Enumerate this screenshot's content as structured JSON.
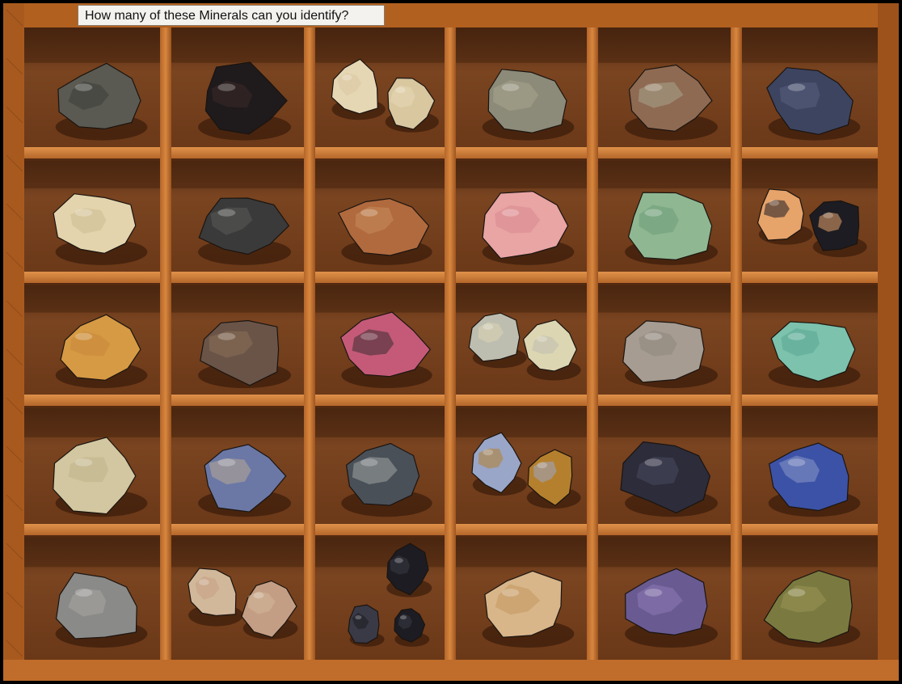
{
  "label": "How many of these Minerals can you identify?",
  "tray": {
    "columns": 6,
    "rows": 5,
    "wood_color": "#b8621f",
    "compartment_color": "#6e3a1c",
    "divider_color": "#c97a36"
  },
  "minerals": [
    {
      "row": 0,
      "col": 0,
      "count": 1,
      "colors": [
        "#5a5a52",
        "#3e3e38"
      ]
    },
    {
      "row": 0,
      "col": 1,
      "count": 1,
      "colors": [
        "#1f1a1c",
        "#3a2a28"
      ]
    },
    {
      "row": 0,
      "col": 2,
      "count": 2,
      "colors": [
        "#e6d7b4",
        "#d9c7a0"
      ]
    },
    {
      "row": 0,
      "col": 3,
      "count": 1,
      "colors": [
        "#8c8a78",
        "#a7a48e"
      ]
    },
    {
      "row": 0,
      "col": 4,
      "count": 1,
      "colors": [
        "#8e6a52",
        "#a8a38a"
      ]
    },
    {
      "row": 0,
      "col": 5,
      "count": 1,
      "colors": [
        "#3c4460",
        "#586080"
      ]
    },
    {
      "row": 1,
      "col": 0,
      "count": 1,
      "colors": [
        "#e3d4ad",
        "#cdbb92"
      ]
    },
    {
      "row": 1,
      "col": 1,
      "count": 1,
      "colors": [
        "#3a3a3a",
        "#5a5a58"
      ]
    },
    {
      "row": 1,
      "col": 2,
      "count": 1,
      "colors": [
        "#b06a3e",
        "#c98a5a"
      ]
    },
    {
      "row": 1,
      "col": 3,
      "count": 1,
      "colors": [
        "#e9a4a4",
        "#d88a8e"
      ]
    },
    {
      "row": 1,
      "col": 4,
      "count": 1,
      "colors": [
        "#8fb892",
        "#6d9c78"
      ]
    },
    {
      "row": 1,
      "col": 5,
      "count": 2,
      "colors": [
        "#e6a36a",
        "#1c1c22"
      ]
    },
    {
      "row": 2,
      "col": 0,
      "count": 1,
      "colors": [
        "#d69a44",
        "#c8893a"
      ]
    },
    {
      "row": 2,
      "col": 1,
      "count": 1,
      "colors": [
        "#6a5448",
        "#8a7056"
      ]
    },
    {
      "row": 2,
      "col": 2,
      "count": 1,
      "colors": [
        "#c45a78",
        "#3c2e32"
      ]
    },
    {
      "row": 2,
      "col": 3,
      "count": 2,
      "colors": [
        "#bdbdb0",
        "#ddd6b2"
      ]
    },
    {
      "row": 2,
      "col": 4,
      "count": 1,
      "colors": [
        "#a69c92",
        "#8e877c"
      ]
    },
    {
      "row": 2,
      "col": 5,
      "count": 1,
      "colors": [
        "#7cc2ac",
        "#5aa894"
      ]
    },
    {
      "row": 3,
      "col": 0,
      "count": 1,
      "colors": [
        "#d2c7a0",
        "#bfb28a"
      ]
    },
    {
      "row": 3,
      "col": 1,
      "count": 1,
      "colors": [
        "#6b78a6",
        "#b8a894"
      ]
    },
    {
      "row": 3,
      "col": 2,
      "count": 1,
      "colors": [
        "#4a5058",
        "#9ea2a0"
      ]
    },
    {
      "row": 3,
      "col": 3,
      "count": 2,
      "colors": [
        "#9aa6c8",
        "#b5802e"
      ]
    },
    {
      "row": 3,
      "col": 4,
      "count": 1,
      "colors": [
        "#2c2c3a",
        "#4a4a60"
      ]
    },
    {
      "row": 3,
      "col": 5,
      "count": 1,
      "colors": [
        "#3c52a6",
        "#8a98c8"
      ]
    },
    {
      "row": 4,
      "col": 0,
      "count": 1,
      "colors": [
        "#8a8a88",
        "#a8a6a2"
      ]
    },
    {
      "row": 4,
      "col": 1,
      "count": 2,
      "colors": [
        "#d2b89a",
        "#c49e84"
      ]
    },
    {
      "row": 4,
      "col": 2,
      "count": 3,
      "colors": [
        "#1c1c22",
        "#3a3a46"
      ]
    },
    {
      "row": 4,
      "col": 3,
      "count": 1,
      "colors": [
        "#d8b68a",
        "#c4985e"
      ]
    },
    {
      "row": 4,
      "col": 4,
      "count": 1,
      "colors": [
        "#6a5a92",
        "#8a7ab4"
      ]
    },
    {
      "row": 4,
      "col": 5,
      "count": 1,
      "colors": [
        "#7a7a40",
        "#9a9456"
      ]
    }
  ]
}
